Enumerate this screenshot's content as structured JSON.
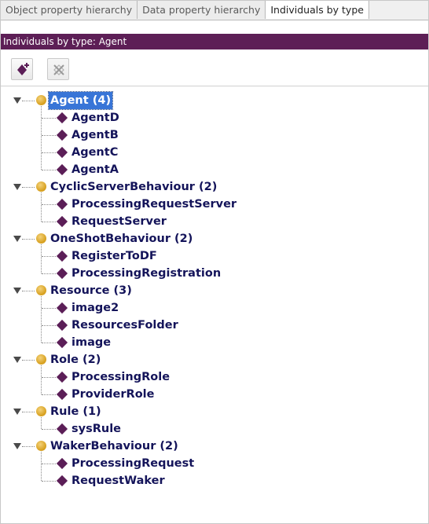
{
  "tabs": [
    {
      "label": "Object property hierarchy",
      "active": false
    },
    {
      "label": "Data property hierarchy",
      "active": false
    },
    {
      "label": "Individuals by type",
      "active": true
    }
  ],
  "view_title": "Individuals by type: Agent",
  "toolbar": {
    "add_icon": "add-individual-icon",
    "delete_icon": "delete-individual-icon"
  },
  "colors": {
    "header_bar": "#5d1f56",
    "individual": "#5b1e57",
    "class": "#d69e1b",
    "selection": "#3875d7",
    "text": "#14145a"
  },
  "tree": [
    {
      "label": "Agent (4)",
      "selected": true,
      "individuals": [
        "AgentD",
        "AgentB",
        "AgentC",
        "AgentA"
      ]
    },
    {
      "label": "CyclicServerBehaviour (2)",
      "selected": false,
      "individuals": [
        "ProcessingRequestServer",
        "RequestServer"
      ]
    },
    {
      "label": "OneShotBehaviour (2)",
      "selected": false,
      "individuals": [
        "RegisterToDF",
        "ProcessingRegistration"
      ]
    },
    {
      "label": "Resource (3)",
      "selected": false,
      "individuals": [
        "image2",
        "ResourcesFolder",
        "image"
      ]
    },
    {
      "label": "Role (2)",
      "selected": false,
      "individuals": [
        "ProcessingRole",
        "ProviderRole"
      ]
    },
    {
      "label": "Rule (1)",
      "selected": false,
      "individuals": [
        "sysRule"
      ]
    },
    {
      "label": "WakerBehaviour (2)",
      "selected": false,
      "individuals": [
        "ProcessingRequest",
        "RequestWaker"
      ]
    }
  ]
}
